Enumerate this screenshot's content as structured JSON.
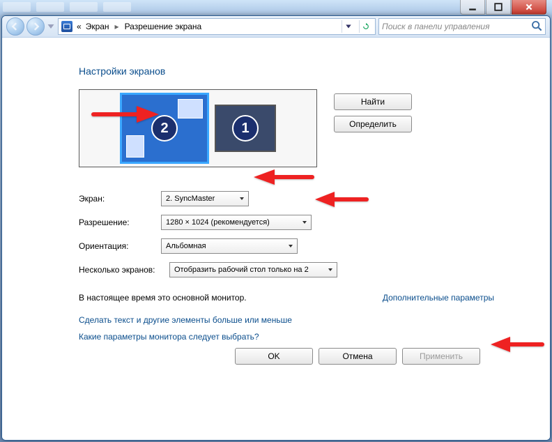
{
  "breadcrumb": {
    "prefix": "«",
    "item1": "Экран",
    "item2": "Разрешение экрана"
  },
  "search": {
    "placeholder": "Поиск в панели управления"
  },
  "title": "Настройки экранов",
  "monitors": {
    "selected": "2",
    "other": "1"
  },
  "buttons": {
    "find": "Найти",
    "identify": "Определить",
    "ok": "OK",
    "cancel": "Отмена",
    "apply": "Применить"
  },
  "labels": {
    "display": "Экран:",
    "resolution": "Разрешение:",
    "orientation": "Ориентация:",
    "multi": "Несколько экранов:"
  },
  "values": {
    "display": "2. SyncMaster",
    "resolution": "1280 × 1024 (рекомендуется)",
    "orientation": "Альбомная",
    "multi": "Отобразить рабочий стол только на 2"
  },
  "note": "В настоящее время это основной монитор.",
  "links": {
    "advanced": "Дополнительные параметры",
    "bigger": "Сделать текст и другие элементы больше или меньше",
    "which": "Какие параметры монитора следует выбрать?"
  }
}
